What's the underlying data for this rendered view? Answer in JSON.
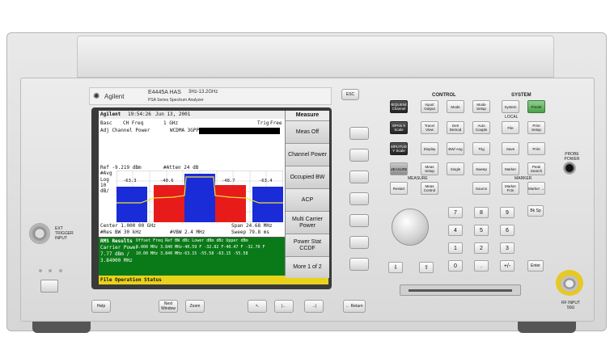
{
  "instrument": {
    "brand": "Agilent",
    "model": "E4445A HAS",
    "range": "3Hz-13.2GHz",
    "series": "PSA Series Spectrum Analyzer",
    "esc_label": "ESC"
  },
  "screen": {
    "header_brand": "Agilent",
    "time": "19:54:26",
    "date": "Jun 13, 2001",
    "basc": "Basc",
    "ch_freq_label": "CH Freq",
    "ch_freq_value": "1 GHz",
    "trig": "Trig",
    "trig_value": "Free",
    "measurement": "Adj Channel Power",
    "standard": "WCDMA 3GPP",
    "ref": "Ref -9.219 dBm",
    "atten": "#Atten 24 dB",
    "avg": "#Avg",
    "scale1": "Log",
    "scale2": "10",
    "scale3": "dB/",
    "bars": [
      "-63.3",
      "-40.6",
      "-48.7",
      "-63.4"
    ],
    "center": "Center 1.000 00 GHz",
    "span": "Span 24.68 MHz",
    "res_bw": "#Res BW 30 kHz",
    "vbw": "#VBW 2.4 MHz",
    "sweep": "Sweep 79.8 ms",
    "rms_title": "RMS Results",
    "carrier_label": "Carrier Power",
    "carrier_value": "7.77 dBm /",
    "carrier_bw": "3.84000 MHz",
    "table_header": "Offset Freq  Ref BW  dBc  Lower  dBm  dBc  Upper  dBm",
    "row1": "5.000 MHz  3.840 MHz-40.59 F  -32.82 F-40.47 F  -32.70 F",
    "row2": "10.00 MHz  3.840 MHz-63.15  -55.58 -63.15  -55.58",
    "status_bar": "File Operation Status"
  },
  "softkeys": {
    "title": "Measure",
    "items": [
      "Meas Off",
      "Channel Power",
      "Occupied BW",
      "ACP",
      "Multi Carrier Power",
      "Power Stat CCDF",
      "More 1 of 2"
    ]
  },
  "control": {
    "title": "CONTROL",
    "measure_title": "MEASURE",
    "marker_title": "MARKER",
    "keys": [
      "FREQUENCY Channel",
      "Input/ Output",
      "Mode",
      "Mode Setup",
      "SPAN X Scale",
      "Trace/ View",
      "Det/ Demod",
      "Auto Couple",
      "AMPLITUDE Y Scale",
      "Display",
      "BW/ Avg",
      "Trig",
      "MEASURE",
      "Meas Setup",
      "Single",
      "Sweep",
      "Restart",
      "Meas Control",
      "Source"
    ]
  },
  "system": {
    "title": "SYSTEM",
    "local": "LOCAL",
    "keys": [
      "System",
      "Preset",
      "File",
      "Print Setup",
      "Save",
      "Print",
      "Marker",
      "Peak Search",
      "Marker Fctn",
      "Marker →"
    ]
  },
  "numpad": {
    "keys": [
      "7",
      "8",
      "9",
      "4",
      "5",
      "6",
      "1",
      "2",
      "3",
      "0",
      ".",
      "+/-"
    ],
    "bksp": "Bk Sp",
    "enter": "Enter"
  },
  "bottom": {
    "help": "Help",
    "next_window": "Next Window",
    "zoom": "Zoom",
    "return": "← Return"
  },
  "ports": {
    "ext_trigger": "EXT TRIGGER INPUT",
    "probe_power": "PROBE POWER",
    "rf_input": "RF INPUT",
    "rf_ohms": "50Ω"
  }
}
